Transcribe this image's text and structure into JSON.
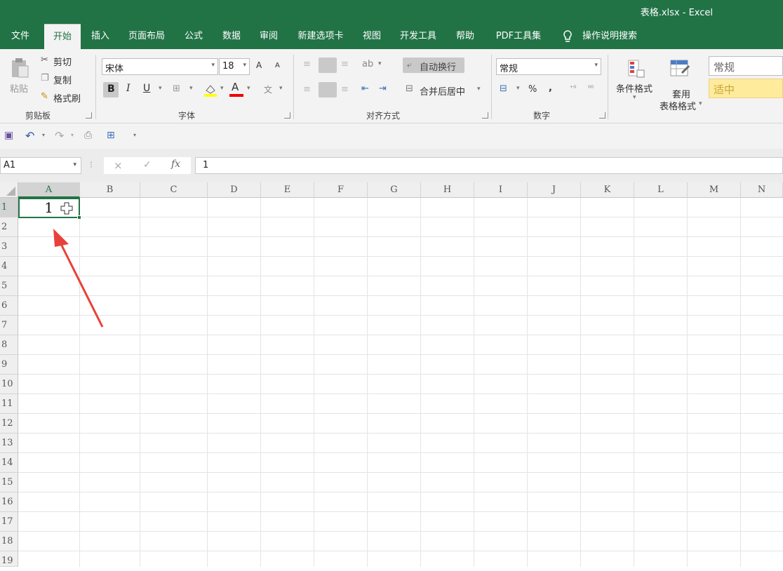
{
  "window": {
    "title": "表格.xlsx  -  Excel"
  },
  "tabs": [
    {
      "label": "文件"
    },
    {
      "label": "开始"
    },
    {
      "label": "插入"
    },
    {
      "label": "页面布局"
    },
    {
      "label": "公式"
    },
    {
      "label": "数据"
    },
    {
      "label": "审阅"
    },
    {
      "label": "新建选项卡"
    },
    {
      "label": "视图"
    },
    {
      "label": "开发工具"
    },
    {
      "label": "帮助"
    },
    {
      "label": "PDF工具集"
    },
    {
      "label": "操作说明搜索"
    }
  ],
  "ribbon": {
    "clipboard": {
      "paste": "粘贴",
      "cut": "剪切",
      "copy": "复制",
      "format_painter": "格式刷",
      "label": "剪贴板"
    },
    "font": {
      "name": "宋体",
      "size": "18",
      "bold": "B",
      "italic": "I",
      "underline": "U",
      "font_color": "A",
      "grow": "A",
      "shrink": "A",
      "label": "字体",
      "wen": "文"
    },
    "alignment": {
      "wrap": "自动换行",
      "merge": "合并后居中",
      "label": "对齐方式"
    },
    "number": {
      "format": "常规",
      "percent": "%",
      "comma": ",",
      "label": "数字"
    },
    "styles": {
      "conditional": "条件格式",
      "table_a": "套用",
      "table_b": "表格格式",
      "style_normal": "常规",
      "style_neutral": "适中"
    }
  },
  "formula_bar": {
    "name_box": "A1",
    "cancel": "×",
    "enter": "✓",
    "fx": "fx",
    "value": "1"
  },
  "sheet": {
    "columns": [
      "A",
      "B",
      "C",
      "D",
      "E",
      "F",
      "G",
      "H",
      "I",
      "J",
      "K",
      "L",
      "M",
      "N"
    ],
    "rows": [
      "1",
      "2",
      "3",
      "4",
      "5",
      "6",
      "7",
      "8",
      "9",
      "10",
      "11",
      "12",
      "13",
      "14",
      "15",
      "16",
      "17",
      "18",
      "19"
    ],
    "cells": {
      "A1": "1"
    }
  },
  "colors": {
    "excel_green": "#217346",
    "annotation_arrow": "#e8413b"
  }
}
